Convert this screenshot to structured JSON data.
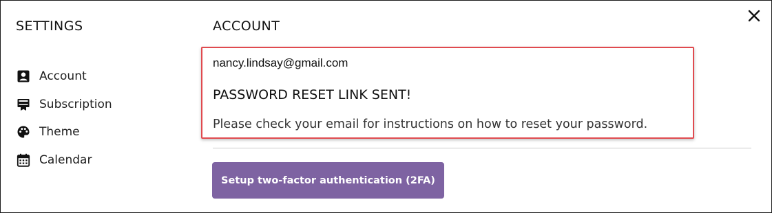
{
  "dialog": {
    "settings_title": "SETTINGS",
    "close_icon": "close-icon"
  },
  "sidebar": {
    "items": [
      {
        "label": "Account",
        "icon": "account-box-icon"
      },
      {
        "label": "Subscription",
        "icon": "subscription-icon"
      },
      {
        "label": "Theme",
        "icon": "palette-icon"
      },
      {
        "label": "Calendar",
        "icon": "calendar-icon"
      }
    ]
  },
  "account": {
    "title": "ACCOUNT",
    "email": "nancy.lindsay@gmail.com",
    "reset_title": "PASSWORD RESET LINK SENT!",
    "reset_message": "Please check your email for instructions on how to reset your password.",
    "twofa_button_label": "Setup two-factor authentication (2FA)"
  },
  "colors": {
    "highlight_border": "#e04a4f",
    "button_bg": "#7e63a2",
    "divider": "#c9c9c9"
  }
}
